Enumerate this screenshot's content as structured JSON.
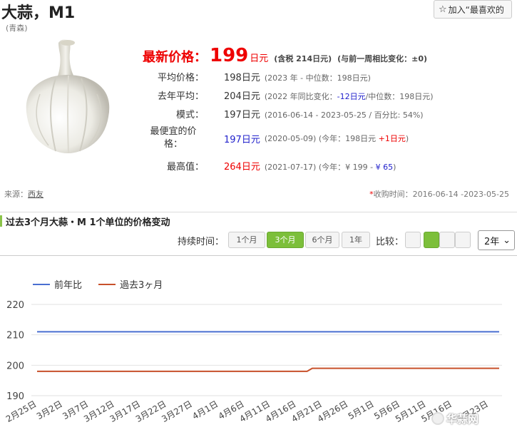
{
  "product": {
    "title": "大蒜，M1",
    "subtitle": "(青森)",
    "favorite_button": "加入“最喜欢的"
  },
  "price": {
    "latest_label": "最新价格：",
    "latest_value": "199",
    "latest_unit": "日元",
    "tax_note": "(含税 214日元)",
    "change_note": "(与前一周相比变化：±0)",
    "rows": [
      {
        "label": "平均价格：",
        "value": "198日元",
        "note": "(2023 年 - 中位数：198日元)"
      },
      {
        "label": "去年平均：",
        "value": "204日元",
        "note_pre": "(2022 年同比变化：",
        "note_hl": "-12日元",
        "note_post": "/中位数：198日元)"
      },
      {
        "label": "模式：",
        "value": "197日元",
        "note": "(2016-06-14 - 2023-05-25 / 百分比: 54%)"
      },
      {
        "label_line1": "最便宜的价",
        "label_line2": "格：",
        "value": "197日元",
        "note_pre": "(2020-05-09) (今年：198日元 ",
        "note_hl": "+1日元",
        "note_post": ")"
      },
      {
        "label": "最高值：",
        "value": "264日元",
        "note_pre": "(2021-07-17) (今年：¥ 199 - ",
        "note_hl": "¥ 65",
        "note_post": ")"
      }
    ]
  },
  "source": {
    "label": "来源：",
    "link": "西友"
  },
  "period": {
    "asterisk": "*",
    "text": "收购时间：2016-06-14 -2023-05-25"
  },
  "section": {
    "title": "过去3个月大蒜・M 1个单位的价格变动"
  },
  "controls": {
    "duration_label": "持续时间：",
    "durations": [
      "1个月",
      "3个月",
      "6个月",
      "1年"
    ],
    "active_duration": "3个月",
    "compare_label": "比较：",
    "year_value": "2年",
    "year_caret": "⌄"
  },
  "watermark": "华蒜网",
  "colors": {
    "accent_green": "#7cbf3a",
    "price_red": "#e00000",
    "series_prev": "#4a6fd1",
    "series_cur": "#c8512b"
  },
  "chart_data": {
    "type": "line",
    "legend_placement": "top-left",
    "grid": true,
    "ylim": [
      190,
      220
    ],
    "yticks": [
      190,
      200,
      210,
      220
    ],
    "x_labels": [
      "2月25日",
      "3月2日",
      "3月7日",
      "3月12日",
      "3月17日",
      "3月22日",
      "3月27日",
      "4月1日",
      "4月6日",
      "4月11日",
      "4月16日",
      "4月21日",
      "4月26日",
      "5月1日",
      "5月6日",
      "5月11日",
      "5月16日",
      "5月23日"
    ],
    "series": [
      {
        "name": "前年比",
        "color": "#4a6fd1",
        "points": [
          {
            "x": "2月25日",
            "y": 211
          },
          {
            "x": "5月25日",
            "y": 211
          }
        ]
      },
      {
        "name": "過去3ヶ月",
        "color": "#c8512b",
        "points": [
          {
            "x": "2月25日",
            "y": 198
          },
          {
            "x": "4月18日",
            "y": 198
          },
          {
            "x": "4月19日",
            "y": 199
          },
          {
            "x": "5月25日",
            "y": 199
          }
        ]
      }
    ]
  }
}
